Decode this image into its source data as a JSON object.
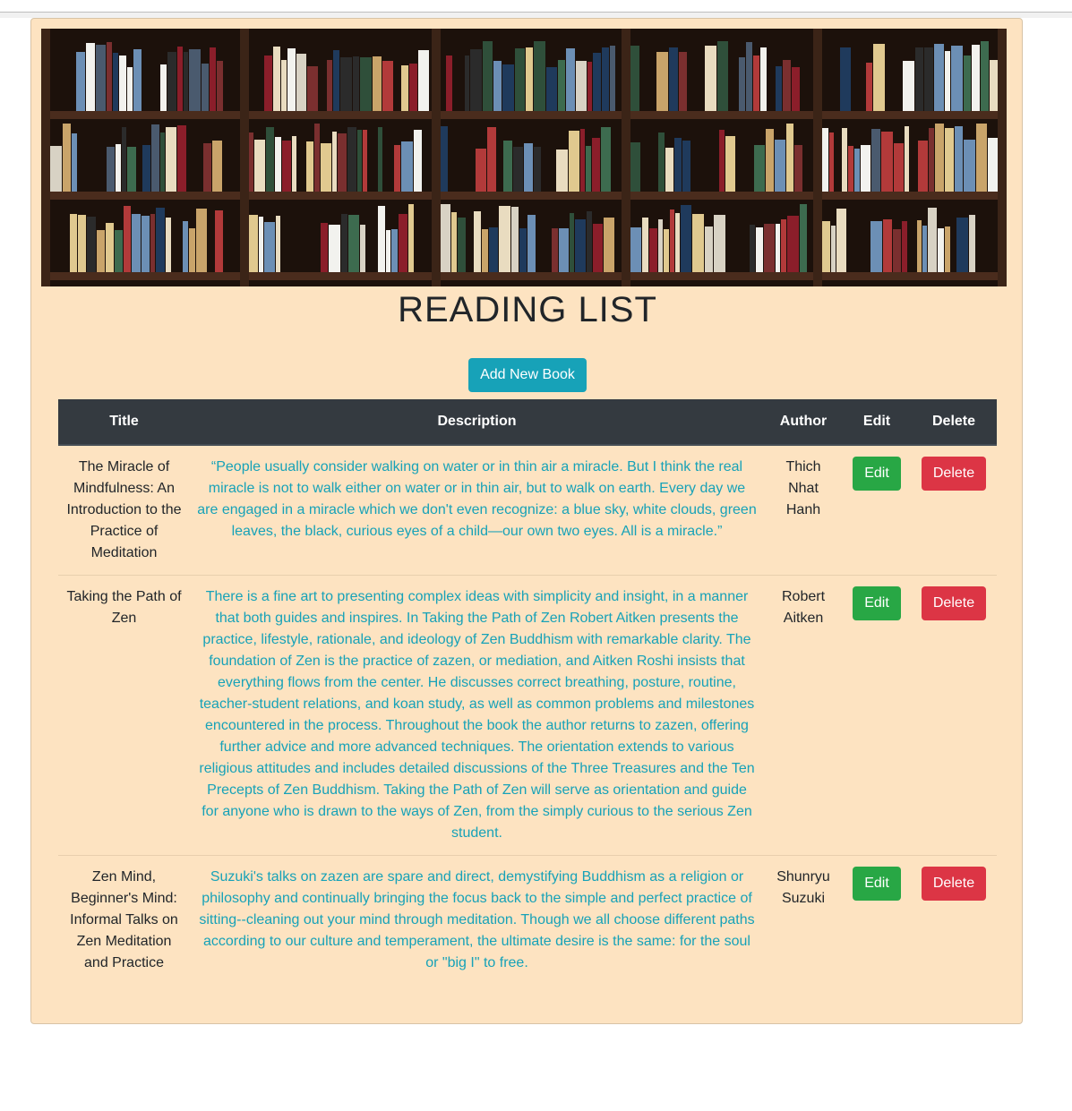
{
  "page": {
    "heading": "READING LIST",
    "add_button_label": "Add New Book",
    "banner_image": "bookshelf-photo"
  },
  "table": {
    "headers": [
      "Title",
      "Description",
      "Author",
      "Edit",
      "Delete"
    ],
    "rows": [
      {
        "title": "The Miracle of Mindfulness: An Introduction to the Practice of Meditation",
        "description": "“People usually consider walking on water or in thin air a miracle. But I think the real miracle is not to walk either on water or in thin air, but to walk on earth. Every day we are engaged in a miracle which we don't even recognize: a blue sky, white clouds, green leaves, the black, curious eyes of a child—our own two eyes. All is a miracle.”",
        "author": "Thich Nhat Hanh",
        "edit_label": "Edit",
        "delete_label": "Delete"
      },
      {
        "title": "Taking the Path of Zen",
        "description": "There is a fine art to presenting complex ideas with simplicity and insight, in a manner that both guides and inspires. In Taking the Path of Zen Robert Aitken presents the practice, lifestyle, rationale, and ideology of Zen Buddhism with remarkable clarity. The foundation of Zen is the practice of zazen, or mediation, and Aitken Roshi insists that everything flows from the center. He discusses correct breathing, posture, routine, teacher-student relations, and koan study, as well as common problems and milestones encountered in the process. Throughout the book the author returns to zazen, offering further advice and more advanced techniques. The orientation extends to various religious attitudes and includes detailed discussions of the Three Treasures and the Ten Precepts of Zen Buddhism. Taking the Path of Zen will serve as orientation and guide for anyone who is drawn to the ways of Zen, from the simply curious to the serious Zen student.",
        "author": "Robert Aitken",
        "edit_label": "Edit",
        "delete_label": "Delete"
      },
      {
        "title": "Zen Mind, Beginner's Mind: Informal Talks on Zen Meditation and Practice",
        "description": "Suzuki's talks on zazen are spare and direct, demystifying Buddhism as a religion or philosophy and continually bringing the focus back to the simple and perfect practice of sitting--cleaning out your mind through meditation. Though we all choose different paths according to our culture and temperament, the ultimate desire is the same: for the soul or \"big I\" to free.",
        "author": "Shunryu Suzuki",
        "edit_label": "Edit",
        "delete_label": "Delete"
      }
    ]
  },
  "colors": {
    "card_background": "#fde3c1",
    "header_background": "#343a40",
    "accent": "#17a2b8",
    "edit": "#28a745",
    "delete": "#dc3545"
  }
}
